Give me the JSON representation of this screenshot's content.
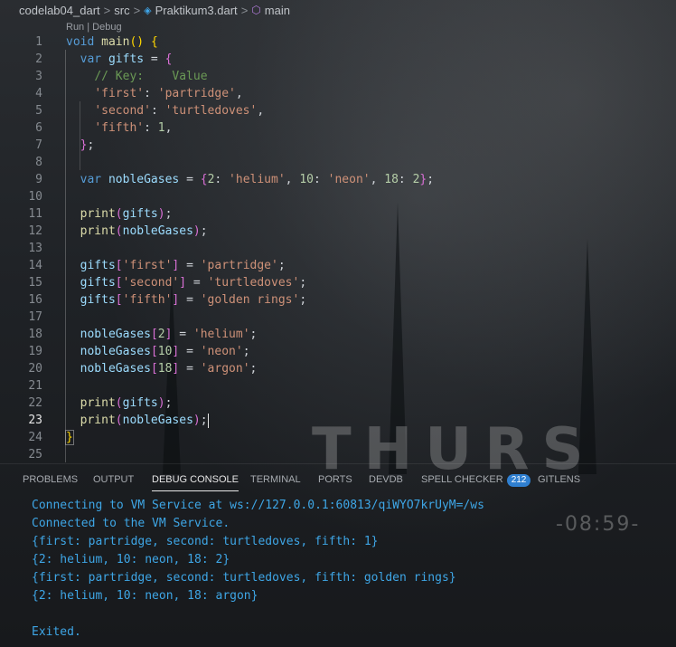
{
  "breadcrumb": {
    "items": [
      "codelab04_dart",
      "src",
      "Praktikum3.dart",
      "main"
    ],
    "separator": ">",
    "icons": [
      "dart-file-icon",
      "symbol-method-icon"
    ]
  },
  "editor": {
    "codelens": "Run | Debug",
    "line_numbers": [
      "1",
      "2",
      "3",
      "4",
      "5",
      "6",
      "7",
      "8",
      "9",
      "10",
      "11",
      "12",
      "13",
      "14",
      "15",
      "16",
      "17",
      "18",
      "19",
      "20",
      "21",
      "22",
      "23",
      "24",
      "25"
    ],
    "active_line": "23",
    "tokens": {
      "l1": [
        "void",
        "main",
        "()",
        " ",
        "{"
      ],
      "l2": [
        "var",
        " ",
        "gifts",
        " = ",
        "{"
      ],
      "l3": [
        "// Key:    Value"
      ],
      "l4": [
        "'first'",
        ": ",
        "'partridge'",
        ","
      ],
      "l5": [
        "'second'",
        ": ",
        "'turtledoves'",
        ","
      ],
      "l6": [
        "'fifth'",
        ": ",
        "1",
        ","
      ],
      "l7": [
        "}",
        ";"
      ],
      "l9": [
        "var",
        " ",
        "nobleGases",
        " = ",
        "{",
        "2",
        ": ",
        "'helium'",
        ", ",
        "10",
        ": ",
        "'neon'",
        ", ",
        "18",
        ": ",
        "2",
        "}",
        ";"
      ],
      "l11": [
        "print",
        "(",
        "gifts",
        ")",
        ";"
      ],
      "l12": [
        "print",
        "(",
        "nobleGases",
        ")",
        ";"
      ],
      "l14": [
        "gifts",
        "[",
        "'first'",
        "]",
        " = ",
        "'partridge'",
        ";"
      ],
      "l15": [
        "gifts",
        "[",
        "'second'",
        "]",
        " = ",
        "'turtledoves'",
        ";"
      ],
      "l16": [
        "gifts",
        "[",
        "'fifth'",
        "]",
        " = ",
        "'golden rings'",
        ";"
      ],
      "l18": [
        "nobleGases",
        "[",
        "2",
        "]",
        " = ",
        "'helium'",
        ";"
      ],
      "l19": [
        "nobleGases",
        "[",
        "10",
        "]",
        " = ",
        "'neon'",
        ";"
      ],
      "l20": [
        "nobleGases",
        "[",
        "18",
        "]",
        " = ",
        "'argon'",
        ";"
      ],
      "l22": [
        "print",
        "(",
        "gifts",
        ")",
        ";"
      ],
      "l23": [
        "print",
        "(",
        "nobleGases",
        ")",
        ";"
      ],
      "l24": [
        "}"
      ]
    }
  },
  "wallpaper": {
    "text": "THURS",
    "time": "-08:59-"
  },
  "panel": {
    "tabs": [
      "PROBLEMS",
      "OUTPUT",
      "DEBUG CONSOLE",
      "TERMINAL",
      "PORTS",
      "DEVDB",
      "SPELL CHECKER",
      "GITLENS"
    ],
    "active_tab": "DEBUG CONSOLE",
    "spell_checker_badge": "212",
    "console_lines": [
      "Connecting to VM Service at ws://127.0.0.1:60813/qiWYO7krUyM=/ws",
      "Connected to the VM Service.",
      "{first: partridge, second: turtledoves, fifth: 1}",
      "{2: helium, 10: neon, 18: 2}",
      "{first: partridge, second: turtledoves, fifth: golden rings}",
      "{2: helium, 10: neon, 18: argon}",
      "",
      "Exited."
    ]
  },
  "colors": {
    "keyword": "#569cd6",
    "function": "#dcdcaa",
    "variable": "#9cdcfe",
    "string": "#ce9178",
    "number": "#b5cea8",
    "comment": "#6a9955",
    "console_text": "#3ea6e6",
    "badge": "#2f7fd0"
  }
}
